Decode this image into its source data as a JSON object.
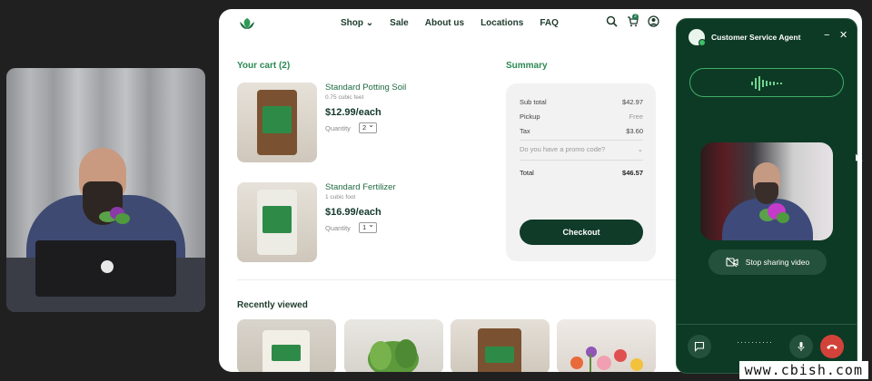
{
  "nav": {
    "links": [
      "Shop",
      "Sale",
      "About us",
      "Locations",
      "FAQ"
    ],
    "cart_count": "2"
  },
  "cart": {
    "title": "Your cart (2)",
    "items": [
      {
        "name": "Standard Potting Soil",
        "size": "0.75 cubic feet",
        "price": "$12.99/each",
        "qty_label": "Quantity",
        "qty": "2"
      },
      {
        "name": "Standard Fertilizer",
        "size": "1 cubic foot",
        "price": "$16.99/each",
        "qty_label": "Quantity",
        "qty": "1"
      }
    ]
  },
  "summary": {
    "title": "Summary",
    "subtotal_label": "Sub total",
    "subtotal": "$42.97",
    "pickup_label": "Pickup",
    "pickup": "Free",
    "tax_label": "Tax",
    "tax": "$3.60",
    "promo": "Do you have a promo code?",
    "total_label": "Total",
    "total": "$46.57",
    "checkout": "Checkout"
  },
  "recent": {
    "title": "Recently viewed"
  },
  "agent": {
    "title": "Customer Service Agent",
    "stop_sharing": "Stop sharing video"
  },
  "watermark": "www.cbish.com",
  "colors": {
    "brand_dark": "#0f3b28",
    "brand_green": "#2c8a52",
    "agent_bg": "#0d3a25",
    "end_call": "#d3423a"
  }
}
